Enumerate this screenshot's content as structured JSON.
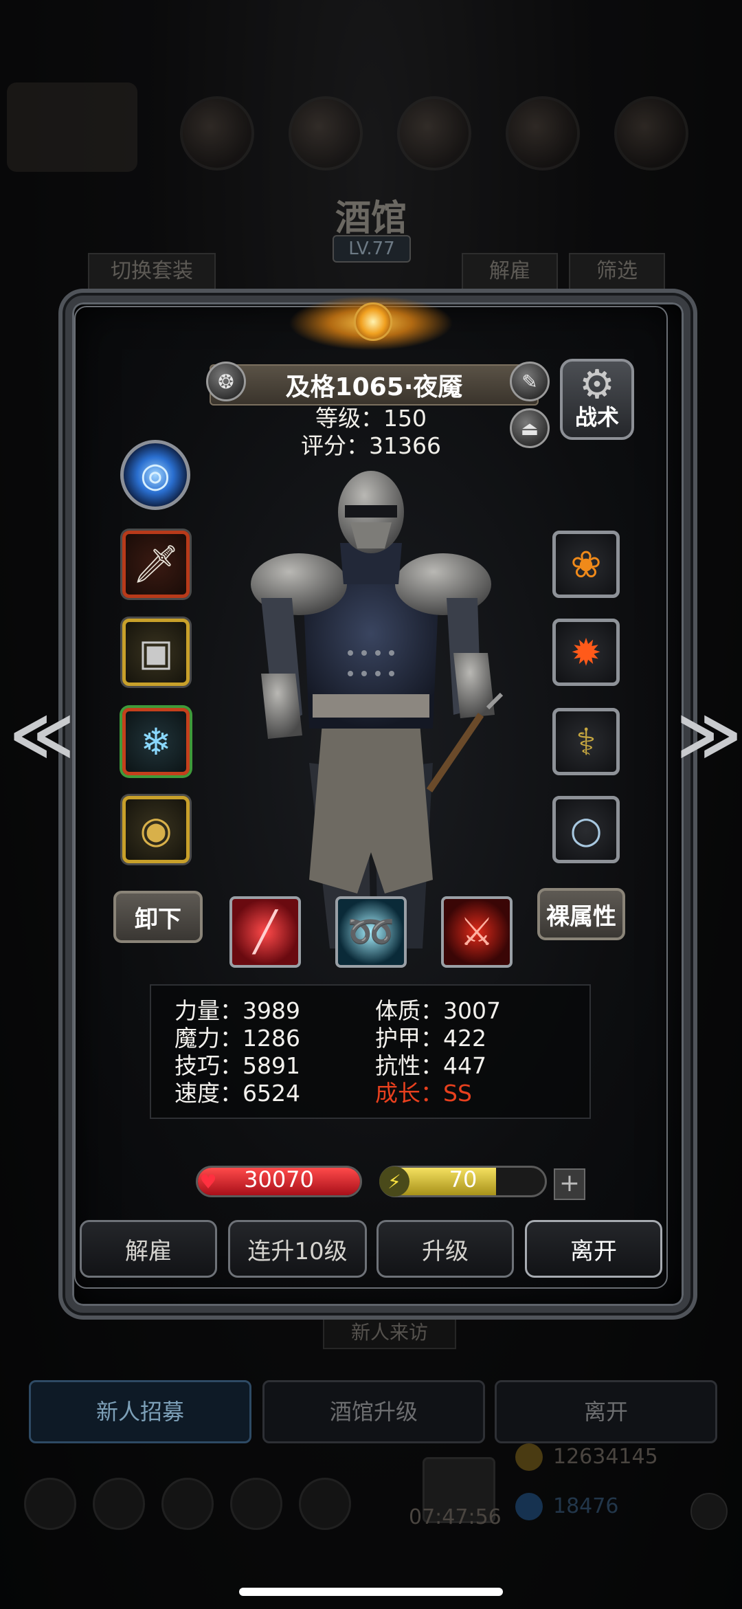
{
  "background": {
    "title": "酒馆",
    "level": "LV.77",
    "switch_set_label": "切换套装",
    "dismiss_tab_label": "解雇",
    "filter_tab_label": "筛选",
    "new_visitor_label": "新人来访",
    "bottom_buttons": [
      "新人招募",
      "酒馆升级",
      "离开"
    ],
    "gold_amount": "12634145",
    "gem_amount": "18476",
    "timer": "07:47:56"
  },
  "hero": {
    "name": "及格1065·夜魇",
    "level_text": "等级：150",
    "score_text": "评分：31366",
    "tactics_label": "战术",
    "unequip_label": "卸下",
    "naked_stats_label": "裸属性"
  },
  "attributes": {
    "strength": "力量：3989",
    "constitution": "体质：3007",
    "magic": "魔力：1286",
    "armor": "护甲：422",
    "skill": "技巧：5891",
    "resistance": "抗性：447",
    "speed": "速度：6524",
    "growth": "成长：SS"
  },
  "bars": {
    "hp_value": "30070",
    "hp_fill": 1.0,
    "energy_value": "70",
    "energy_fill": 0.7,
    "plus_label": "+"
  },
  "actions": {
    "dismiss": "解雇",
    "upgrade10": "连升10级",
    "upgrade": "升级",
    "leave": "离开"
  },
  "colors": {
    "growth": "#e8401e",
    "hp": "#d0202a",
    "energy": "#e6d23a"
  }
}
